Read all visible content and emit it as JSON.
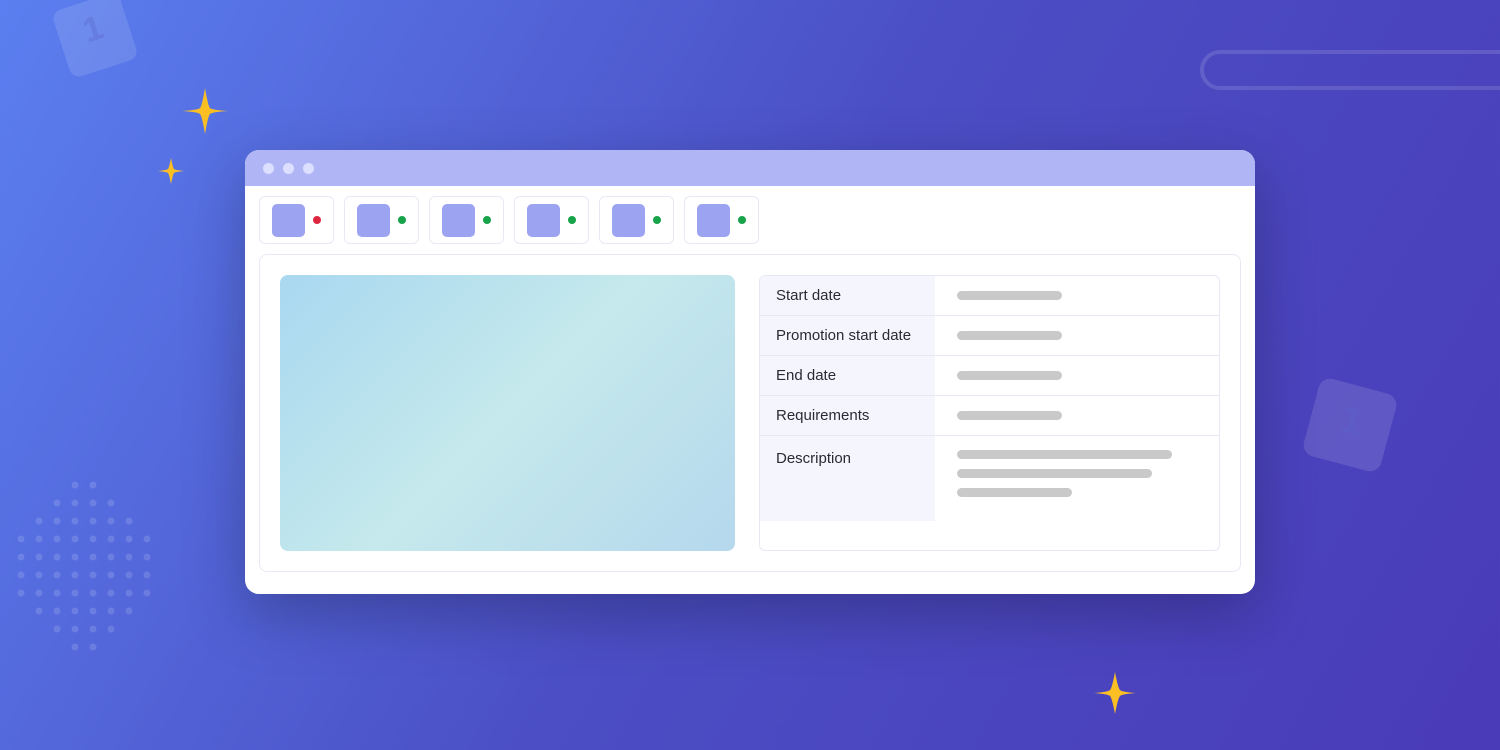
{
  "tabs": [
    {
      "status": "red"
    },
    {
      "status": "green"
    },
    {
      "status": "green"
    },
    {
      "status": "green"
    },
    {
      "status": "green"
    },
    {
      "status": "green"
    }
  ],
  "fields": [
    {
      "label": "Start date"
    },
    {
      "label": "Promotion start date"
    },
    {
      "label": "End date"
    },
    {
      "label": "Requirements"
    },
    {
      "label": "Description"
    }
  ]
}
